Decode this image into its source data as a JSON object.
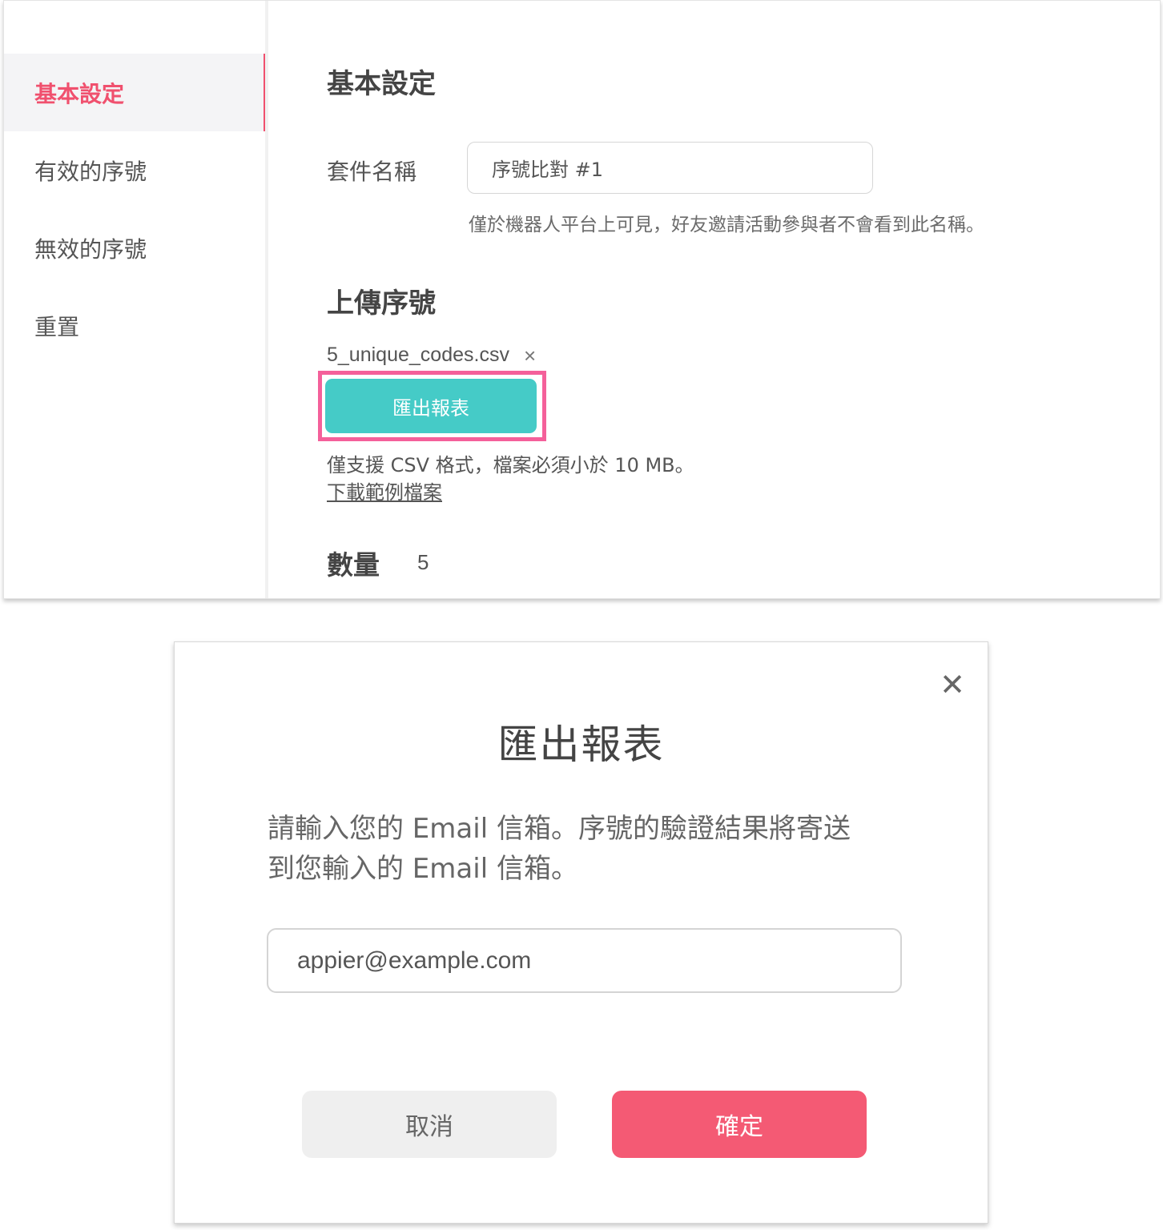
{
  "sidebar": {
    "items": [
      {
        "label": "基本設定",
        "active": true
      },
      {
        "label": "有效的序號",
        "active": false
      },
      {
        "label": "無效的序號",
        "active": false
      },
      {
        "label": "重置",
        "active": false
      }
    ]
  },
  "settings": {
    "section_title": "基本設定",
    "package_name_label": "套件名稱",
    "package_name_value": "序號比對 #1",
    "package_name_hint": "僅於機器人平台上可見，好友邀請活動參與者不會看到此名稱。"
  },
  "upload": {
    "section_title": "上傳序號",
    "filename": "5_unique_codes.csv",
    "remove_icon": "×",
    "export_button": "匯出報表",
    "note": "僅支援 CSV 格式，檔案必須小於 10 MB。",
    "sample_link": "下載範例檔案"
  },
  "quantity": {
    "label": "數量",
    "value": "5"
  },
  "modal": {
    "close_icon": "✕",
    "title": "匯出報表",
    "message_line1": "請輸入您的 Email 信箱。序號的驗證結果將寄送",
    "message_line2": "到您輸入的 Email 信箱。",
    "email_placeholder": "appier@example.com",
    "cancel_label": "取消",
    "confirm_label": "確定"
  },
  "colors": {
    "accent_pink": "#f0506e",
    "highlight_pink": "#f4609a",
    "teal": "#45cbc7",
    "confirm_red": "#f45a74"
  }
}
